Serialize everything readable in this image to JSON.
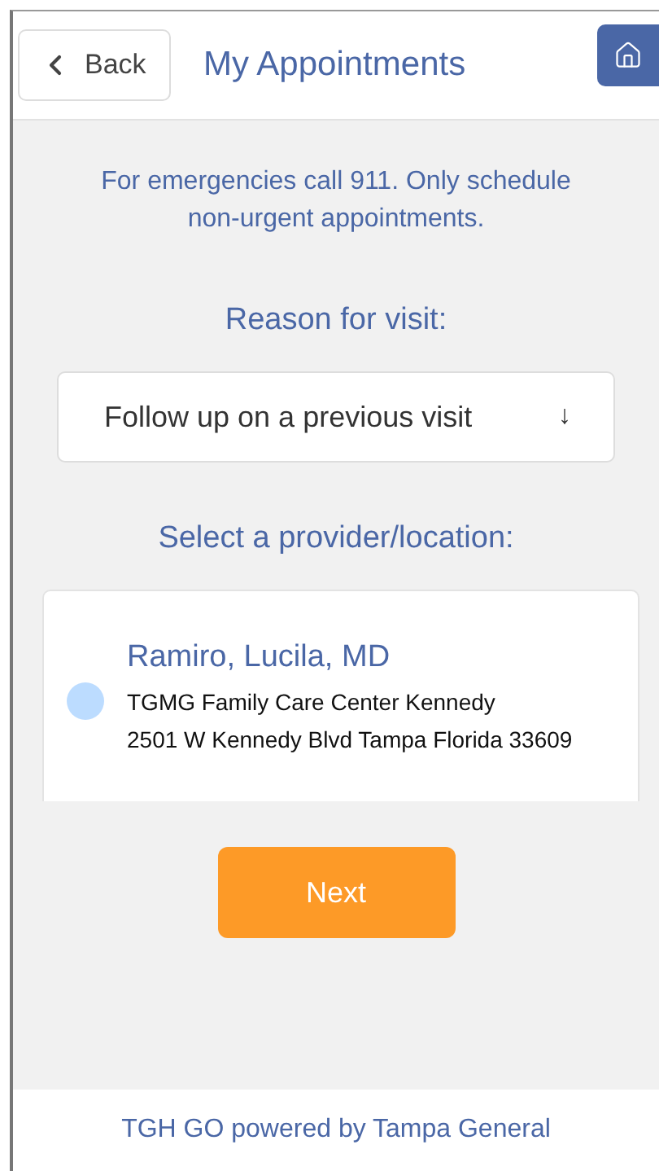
{
  "header": {
    "back_label": "Back",
    "title": "My Appointments"
  },
  "notice": "For emergencies call 911. Only schedule non-urgent appointments.",
  "reason": {
    "label": "Reason for visit:",
    "value": "Follow up on a previous visit",
    "arrow": "↓"
  },
  "provider_section": {
    "label": "Select a provider/location:"
  },
  "providers": [
    {
      "name": "Ramiro, Lucila, MD",
      "location": "TGMG Family Care Center Kennedy",
      "address": "2501 W Kennedy Blvd Tampa Florida 33609",
      "selected": false
    }
  ],
  "next_button": "Next",
  "footer": "TGH GO powered by Tampa General"
}
